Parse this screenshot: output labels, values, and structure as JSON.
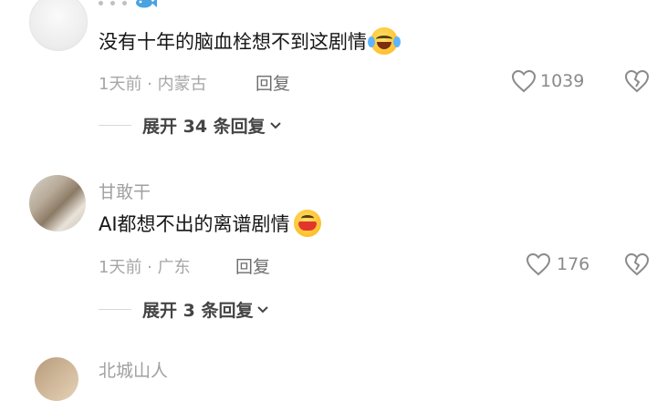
{
  "comments": [
    {
      "text": "没有十年的脑血栓想不到这剧情",
      "emoji": "rolling-laughing-emoji",
      "time_location": "1天前 · 内蒙古",
      "reply_label": "回复",
      "likes": "1039",
      "expand_label": "展开 34 条回复"
    },
    {
      "username": "甘敢干",
      "text": "AI都想不出的离谱剧情",
      "emoji": "grinning-squint-emoji",
      "time_location": "1天前 · 广东",
      "reply_label": "回复",
      "likes": "176",
      "expand_label": "展开 3 条回复"
    },
    {
      "username": "北城山人"
    }
  ],
  "colors": {
    "background": "#ffffff",
    "text": "#161616",
    "muted": "#a6a6a6"
  }
}
